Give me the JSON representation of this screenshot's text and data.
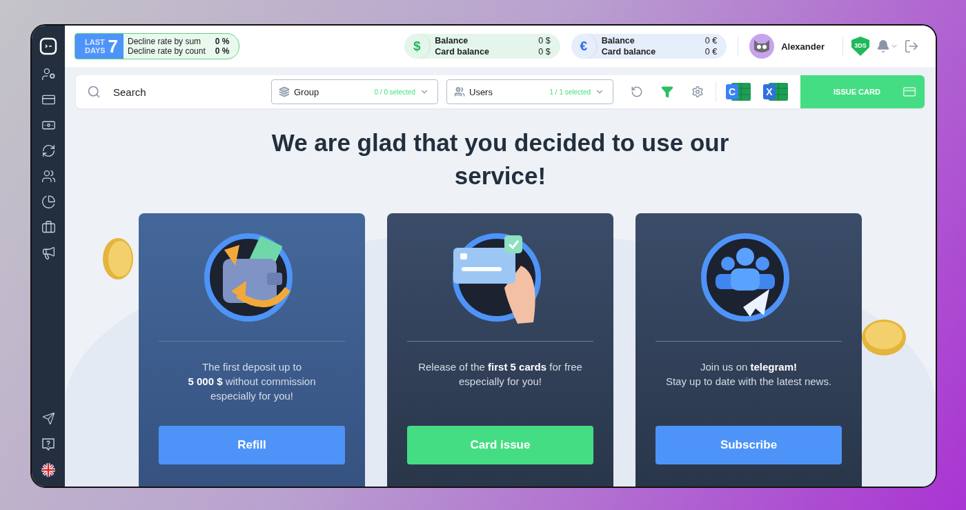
{
  "header": {
    "period": {
      "top": "LAST",
      "bottom": "DAYS",
      "number": "7"
    },
    "decline_rates": [
      {
        "label": "Decline rate by sum",
        "value": "0 %"
      },
      {
        "label": "Decline rate by count",
        "value": "0 %"
      }
    ],
    "balances": [
      {
        "symbol": "$",
        "color": "#1fb85a",
        "rows": [
          {
            "label": "Balance",
            "value": "0 $"
          },
          {
            "label": "Card balance",
            "value": "0 $"
          }
        ]
      },
      {
        "symbol": "€",
        "color": "#2f6fe0",
        "rows": [
          {
            "label": "Balance",
            "value": "0 €"
          },
          {
            "label": "Card balance",
            "value": "0 €"
          }
        ]
      }
    ],
    "user": {
      "name": "Alexander"
    },
    "security_badge": "3DS"
  },
  "toolbar": {
    "search": {
      "placeholder": "Search"
    },
    "dropdowns": [
      {
        "kind": "group",
        "label": "Group",
        "count": "0 / 0 selected"
      },
      {
        "kind": "users",
        "label": "Users",
        "count": "1 / 1 selected"
      }
    ],
    "exports": [
      {
        "letter": "C",
        "color": "#3b82f6"
      },
      {
        "letter": "X",
        "color": "#2f6fe0"
      }
    ],
    "issue_button": "ISSUE CARD"
  },
  "headline": "We are glad that you decided to use our service!",
  "cards": [
    {
      "kind": "wallet",
      "text": "The first deposit up to\n**5 000 $** without commission\nespecially for you!",
      "button": "Refill",
      "color": "#4e94f8"
    },
    {
      "kind": "card",
      "text": "Release of the **first 5 cards** for free\nespecially for you!",
      "button": "Card issue",
      "color": "#45dd83"
    },
    {
      "kind": "community",
      "text": "Join us on **telegram!**\nStay up to date with the latest news.",
      "button": "Subscribe",
      "color": "#4e94f8"
    }
  ]
}
